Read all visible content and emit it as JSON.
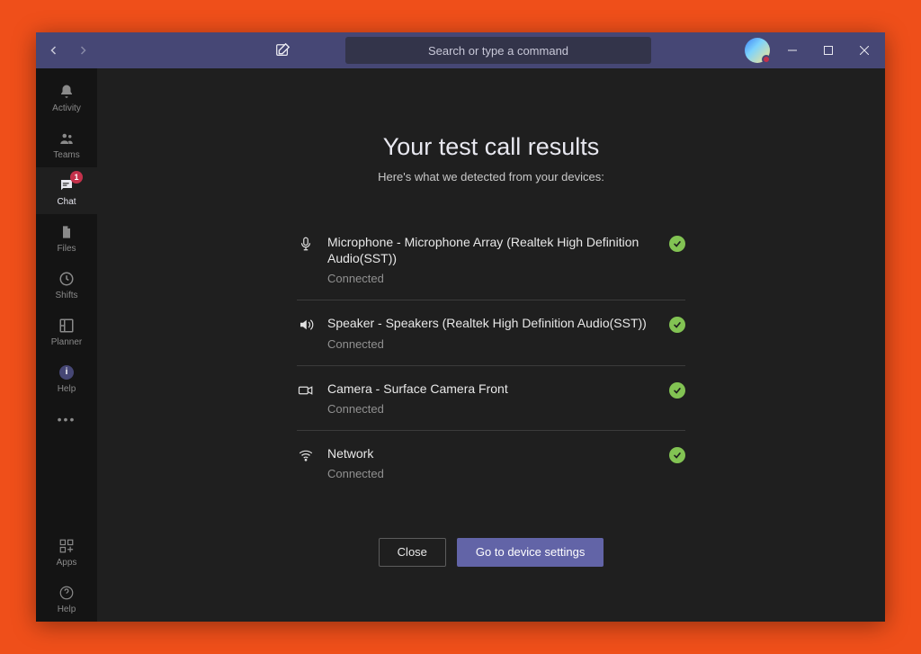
{
  "titlebar": {
    "search_placeholder": "Search or type a command"
  },
  "sidebar": {
    "items": [
      {
        "label": "Activity"
      },
      {
        "label": "Teams"
      },
      {
        "label": "Chat",
        "badge": "1"
      },
      {
        "label": "Files"
      },
      {
        "label": "Shifts"
      },
      {
        "label": "Planner"
      },
      {
        "label": "Help"
      }
    ],
    "bottom": {
      "apps": "Apps",
      "help": "Help"
    }
  },
  "main": {
    "heading": "Your test call results",
    "subheading": "Here's what we detected from your devices:",
    "rows": [
      {
        "title": "Microphone - Microphone Array (Realtek High Definition Audio(SST))",
        "status": "Connected"
      },
      {
        "title": "Speaker - Speakers (Realtek High Definition Audio(SST))",
        "status": "Connected"
      },
      {
        "title": "Camera - Surface Camera Front",
        "status": "Connected"
      },
      {
        "title": "Network",
        "status": "Connected"
      }
    ],
    "buttons": {
      "close": "Close",
      "settings": "Go to device settings"
    }
  },
  "colors": {
    "brand": "#464775",
    "accent": "#6264a7",
    "success": "#82c353",
    "busy": "#c4314b"
  }
}
